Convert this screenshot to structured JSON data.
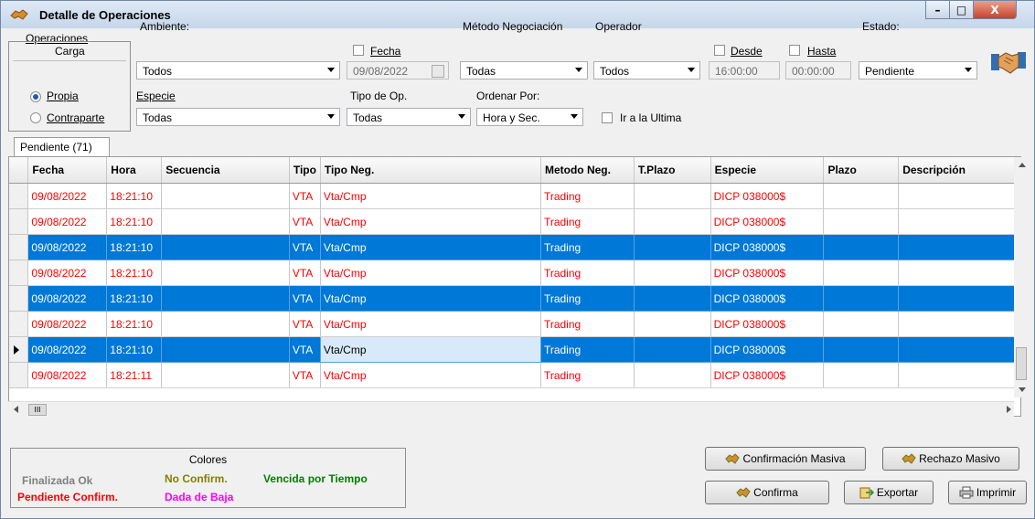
{
  "window": {
    "title": "Detalle de Operaciones",
    "minimize": "–",
    "maximize": "□",
    "close": "X"
  },
  "filters": {
    "operaciones_label": "Operaciones",
    "carga_label": "Carga",
    "propia_label": "Propia",
    "contraparte_label": "Contraparte",
    "ambiente_label": "Ambiente:",
    "ambiente_value": "Todos",
    "especie_label": "Especie",
    "especie_value": "Todas",
    "fecha_label": "Fecha",
    "fecha_value": "09/08/2022",
    "tipo_op_label": "Tipo de Op.",
    "tipo_op_value": "Todas",
    "metodo_label": "Método Negociación",
    "metodo_value": "Todas",
    "ordenar_label": "Ordenar Por:",
    "ordenar_value": "Hora y Sec.",
    "operador_label": "Operador",
    "operador_value": "Todos",
    "desde_label": "Desde",
    "desde_value": "16:00:00",
    "hasta_label": "Hasta",
    "hasta_value": "00:00:00",
    "estado_label": "Estado:",
    "estado_value": "Pendiente",
    "ir_ultima_label": "Ir a la Ultima"
  },
  "tab": {
    "label": "Pendiente (71)"
  },
  "grid": {
    "columns": [
      "Fecha",
      "Hora",
      "Secuencia",
      "Tipo",
      "Tipo Neg.",
      "Metodo Neg.",
      "T.Plazo",
      "Especie",
      "Plazo",
      "Descripción"
    ],
    "rows": [
      {
        "fecha": "09/08/2022",
        "hora": "18:21:10",
        "secuencia": "",
        "tipo": "VTA",
        "tipo_neg": "Vta/Cmp",
        "metodo": "Trading",
        "tplazo": "",
        "especie": "DICP  038000$",
        "plazo": "",
        "desc": "",
        "state": "pend"
      },
      {
        "fecha": "09/08/2022",
        "hora": "18:21:10",
        "secuencia": "",
        "tipo": "VTA",
        "tipo_neg": "Vta/Cmp",
        "metodo": "Trading",
        "tplazo": "",
        "especie": "DICP  038000$",
        "plazo": "",
        "desc": "",
        "state": "pend"
      },
      {
        "fecha": "09/08/2022",
        "hora": "18:21:10",
        "secuencia": "",
        "tipo": "VTA",
        "tipo_neg": "Vta/Cmp",
        "metodo": "Trading",
        "tplazo": "",
        "especie": "DICP  038000$",
        "plazo": "",
        "desc": "",
        "state": "sel"
      },
      {
        "fecha": "09/08/2022",
        "hora": "18:21:10",
        "secuencia": "",
        "tipo": "VTA",
        "tipo_neg": "Vta/Cmp",
        "metodo": "Trading",
        "tplazo": "",
        "especie": "DICP  038000$",
        "plazo": "",
        "desc": "",
        "state": "pend"
      },
      {
        "fecha": "09/08/2022",
        "hora": "18:21:10",
        "secuencia": "",
        "tipo": "VTA",
        "tipo_neg": "Vta/Cmp",
        "metodo": "Trading",
        "tplazo": "",
        "especie": "DICP  038000$",
        "plazo": "",
        "desc": "",
        "state": "sel"
      },
      {
        "fecha": "09/08/2022",
        "hora": "18:21:10",
        "secuencia": "",
        "tipo": "VTA",
        "tipo_neg": "Vta/Cmp",
        "metodo": "Trading",
        "tplazo": "",
        "especie": "DICP  038000$",
        "plazo": "",
        "desc": "",
        "state": "pend"
      },
      {
        "fecha": "09/08/2022",
        "hora": "18:21:10",
        "secuencia": "",
        "tipo": "VTA",
        "tipo_neg": "Vta/Cmp",
        "metodo": "Trading",
        "tplazo": "",
        "especie": "DICP  038000$",
        "plazo": "",
        "desc": "",
        "state": "sel",
        "current": true
      },
      {
        "fecha": "09/08/2022",
        "hora": "18:21:11",
        "secuencia": "",
        "tipo": "VTA",
        "tipo_neg": "Vta/Cmp",
        "metodo": "Trading",
        "tplazo": "",
        "especie": "DICP  038000$",
        "plazo": "",
        "desc": "",
        "state": "pend"
      }
    ]
  },
  "legend": {
    "title": "Colores",
    "finalizada": "Finalizada Ok",
    "no_confirm": "No Confirm.",
    "vencida": "Vencida por Tiempo",
    "pendiente": "Pendiente Confirm.",
    "dada_baja": "Dada de Baja",
    "colors": {
      "finalizada": "#808080",
      "no_confirm": "#808000",
      "vencida": "#008000",
      "pendiente": "#ff0000",
      "dada_baja": "#ff00ff"
    }
  },
  "buttons": {
    "confirmacion_masiva": "Confirmación Masiva",
    "rechazo_masivo": "Rechazo Masivo",
    "confirma": "Confirma",
    "exportar": "Exportar",
    "imprimir": "Imprimir"
  },
  "scroll": {
    "hscroll_thumb": "III"
  }
}
